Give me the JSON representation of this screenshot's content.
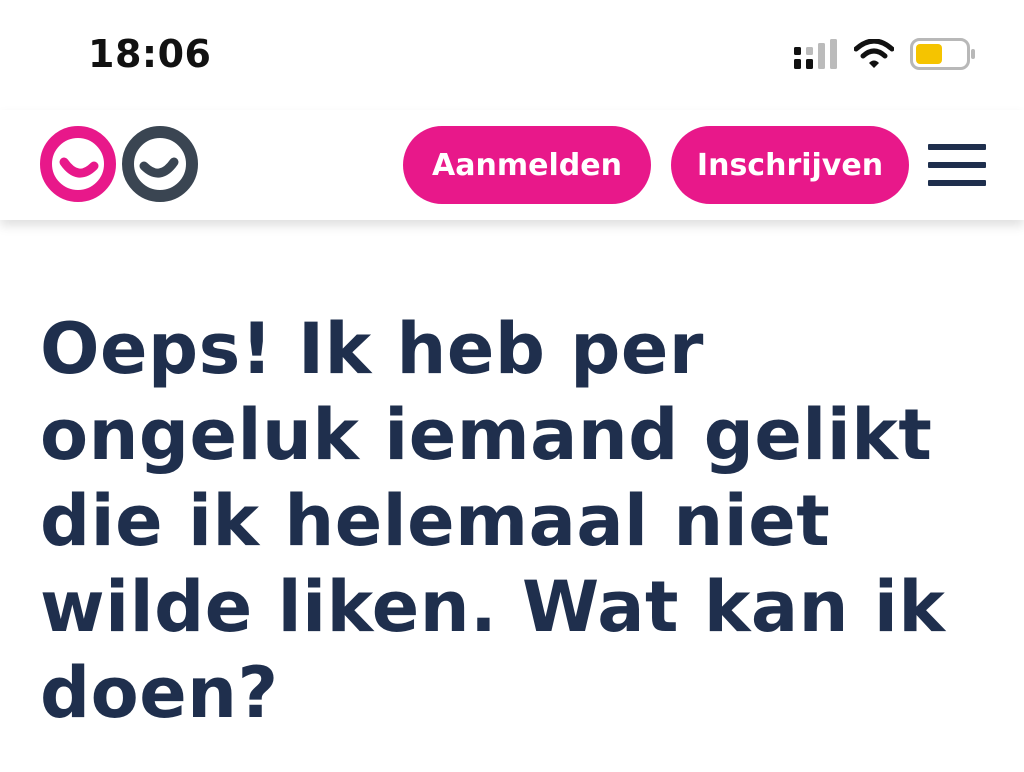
{
  "status_bar": {
    "time": "18:06",
    "icons": [
      "signal-icon",
      "wifi-icon",
      "battery-icon"
    ],
    "battery_color": "#f5c400"
  },
  "header": {
    "logo": "logo-icon",
    "login_label": "Aanmelden",
    "signup_label": "Inschrijven",
    "menu_icon": "hamburger-menu-icon"
  },
  "main": {
    "title": "Oeps! Ik heb per ongeluk iemand gelikt die ik helemaal niet wilde liken. Wat kan ik doen?"
  },
  "colors": {
    "brand_pink": "#e8188a",
    "brand_navy": "#1f2f4d",
    "logo_gray": "#3a4552"
  }
}
